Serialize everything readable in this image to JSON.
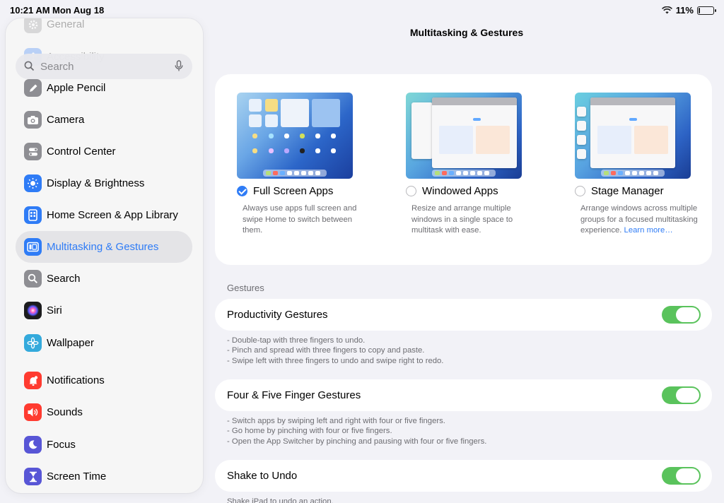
{
  "status_bar": {
    "time": "10:21 AM",
    "date": "Mon Aug 18",
    "battery": "11%",
    "battery_level": 0.11
  },
  "search": {
    "placeholder": "Search"
  },
  "sidebar": {
    "items": [
      {
        "label": "General",
        "icon": "gear-icon",
        "color": "#8e8e93"
      },
      {
        "label": "Accessibility",
        "icon": "accessibility-icon",
        "color": "#2f7cf6"
      },
      {
        "label": "Apple Pencil",
        "icon": "pencil-icon",
        "color": "#8e8e93"
      },
      {
        "label": "Camera",
        "icon": "camera-icon",
        "color": "#8e8e93"
      },
      {
        "label": "Control Center",
        "icon": "toggles-icon",
        "color": "#8e8e93"
      },
      {
        "label": "Display & Brightness",
        "icon": "sun-icon",
        "color": "#2f7cf6"
      },
      {
        "label": "Home Screen & App Library",
        "icon": "home-screen-icon",
        "color": "#2f7cf6"
      },
      {
        "label": "Multitasking & Gestures",
        "icon": "multitasking-icon",
        "color": "#2f7cf6"
      },
      {
        "label": "Search",
        "icon": "search-icon",
        "color": "#8e8e93"
      },
      {
        "label": "Siri",
        "icon": "siri-icon",
        "color": "#222222"
      },
      {
        "label": "Wallpaper",
        "icon": "flower-icon",
        "color": "#34aadc"
      },
      {
        "label": "Notifications",
        "icon": "bell-icon",
        "color": "#ff3b30"
      },
      {
        "label": "Sounds",
        "icon": "speaker-icon",
        "color": "#ff3b30"
      },
      {
        "label": "Focus",
        "icon": "moon-icon",
        "color": "#5856d6"
      },
      {
        "label": "Screen Time",
        "icon": "hourglass-icon",
        "color": "#5856d6"
      }
    ]
  },
  "main": {
    "title": "Multitasking & Gestures",
    "modes": [
      {
        "name": "Full Screen Apps",
        "selected": true,
        "desc": "Always use apps full screen and swipe Home to switch between them."
      },
      {
        "name": "Windowed Apps",
        "selected": false,
        "desc": "Resize and arrange multiple windows in a single space to multitask with ease."
      },
      {
        "name": "Stage Manager",
        "selected": false,
        "desc": "Arrange windows across multiple groups for a focused multitasking experience.",
        "link": "Learn more…"
      }
    ],
    "gestures_header": "Gestures",
    "rows": [
      {
        "label": "Productivity Gestures",
        "on": true,
        "footer": [
          "- Double-tap with three fingers to undo.",
          "- Pinch and spread with three fingers to copy and paste.",
          "- Swipe left with three fingers to undo and swipe right to redo."
        ]
      },
      {
        "label": "Four & Five Finger Gestures",
        "on": true,
        "footer": [
          "- Switch apps by swiping left and right with four or five fingers.",
          "- Go home by pinching with four or five fingers.",
          "- Open the App Switcher by pinching and pausing with four or five fingers."
        ]
      },
      {
        "label": "Shake to Undo",
        "on": true,
        "footer": [
          "Shake iPad to undo an action."
        ]
      }
    ]
  },
  "colors": {
    "accent": "#2f7cf6",
    "toggle_on": "#5ac35c"
  }
}
